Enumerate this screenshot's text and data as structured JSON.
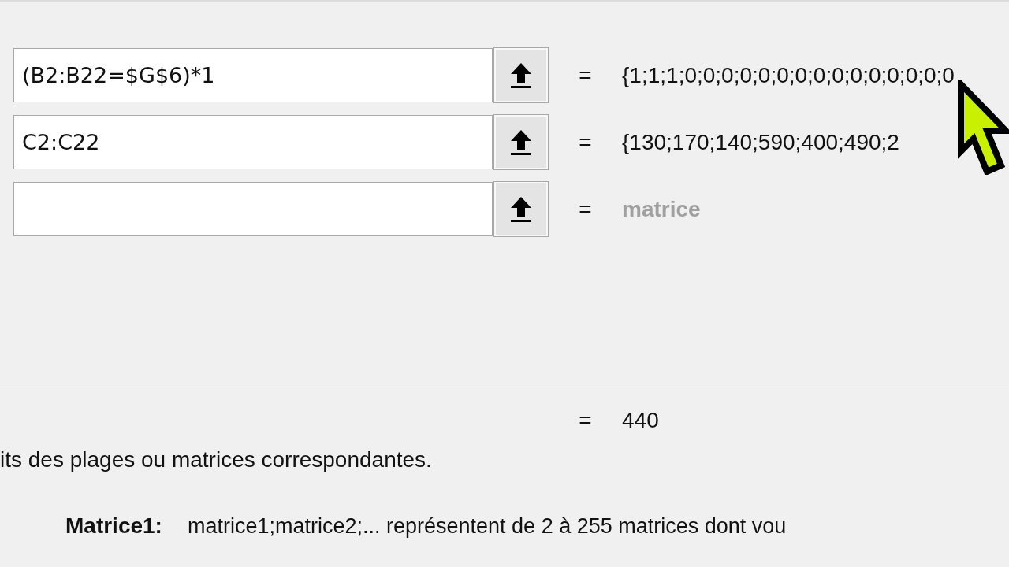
{
  "arguments": [
    {
      "value": "(B2:B22=$G$6)*1",
      "equals": "=",
      "result": "{1;1;1;0;0;0;0;0;0;0;0;0;0;0;0;0;0;0",
      "kind": "value"
    },
    {
      "value": "C2:C22",
      "equals": "=",
      "result": "{130;170;140;590;400;490;2",
      "kind": "value"
    },
    {
      "equals": "=",
      "result": "matrice",
      "kind": "hint"
    }
  ],
  "formula_result": {
    "equals": "=",
    "value": "440"
  },
  "description": "its des plages ou matrices correspondantes.",
  "argument_help": {
    "label": "Matrice1:",
    "text": "matrice1;matrice2;... représentent de 2 à 255 matrices dont vou"
  }
}
